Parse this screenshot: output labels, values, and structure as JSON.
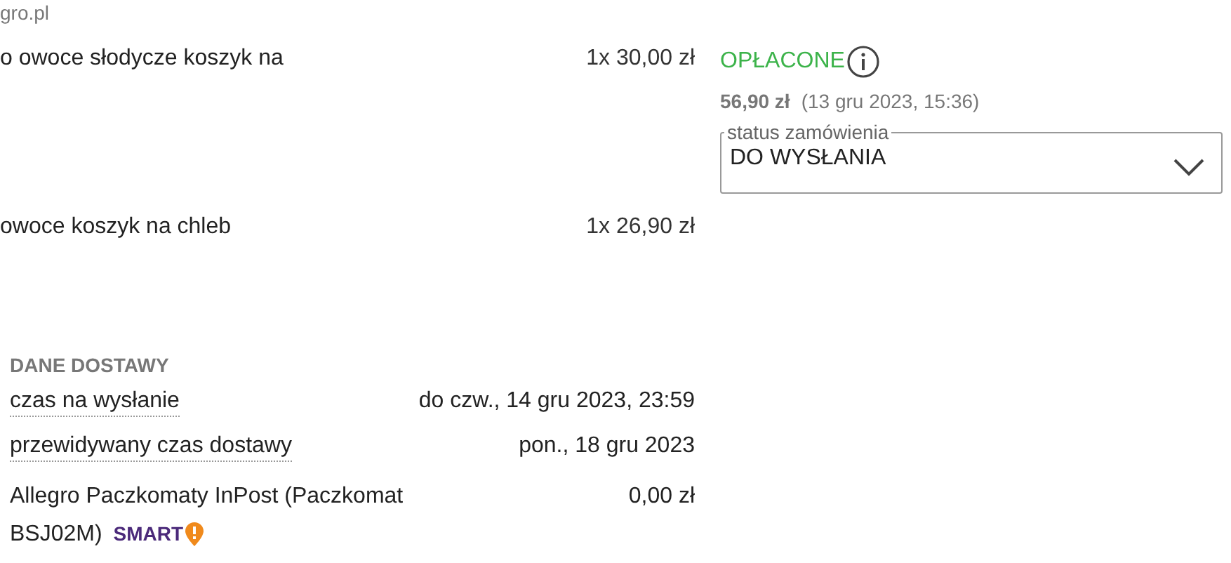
{
  "seller": "gro.pl",
  "items": [
    {
      "name": "o owoce słodycze koszyk na",
      "quantity": "1x",
      "price": "30,00 zł"
    },
    {
      "name": "owoce koszyk na chleb",
      "quantity": "1x",
      "price": "26,90 zł"
    }
  ],
  "delivery": {
    "title": "DANE DOSTAWY",
    "rows": [
      {
        "label": "czas na wysłanie",
        "value": "do czw., 14 gru 2023, 23:59"
      },
      {
        "label": "przewidywany czas dostawy",
        "value": "pon., 18 gru 2023"
      }
    ],
    "method": {
      "name": "Allegro Paczkomaty InPost (Paczkomat BSJ02M)",
      "badge": "SMART",
      "price": "0,00 zł"
    }
  },
  "payment": {
    "status": "OPŁACONE",
    "amount": "56,90 zł",
    "date": "(13 gru 2023, 15:36)"
  },
  "order_status": {
    "label": "status zamówienia",
    "value": "DO WYSŁANIA"
  }
}
